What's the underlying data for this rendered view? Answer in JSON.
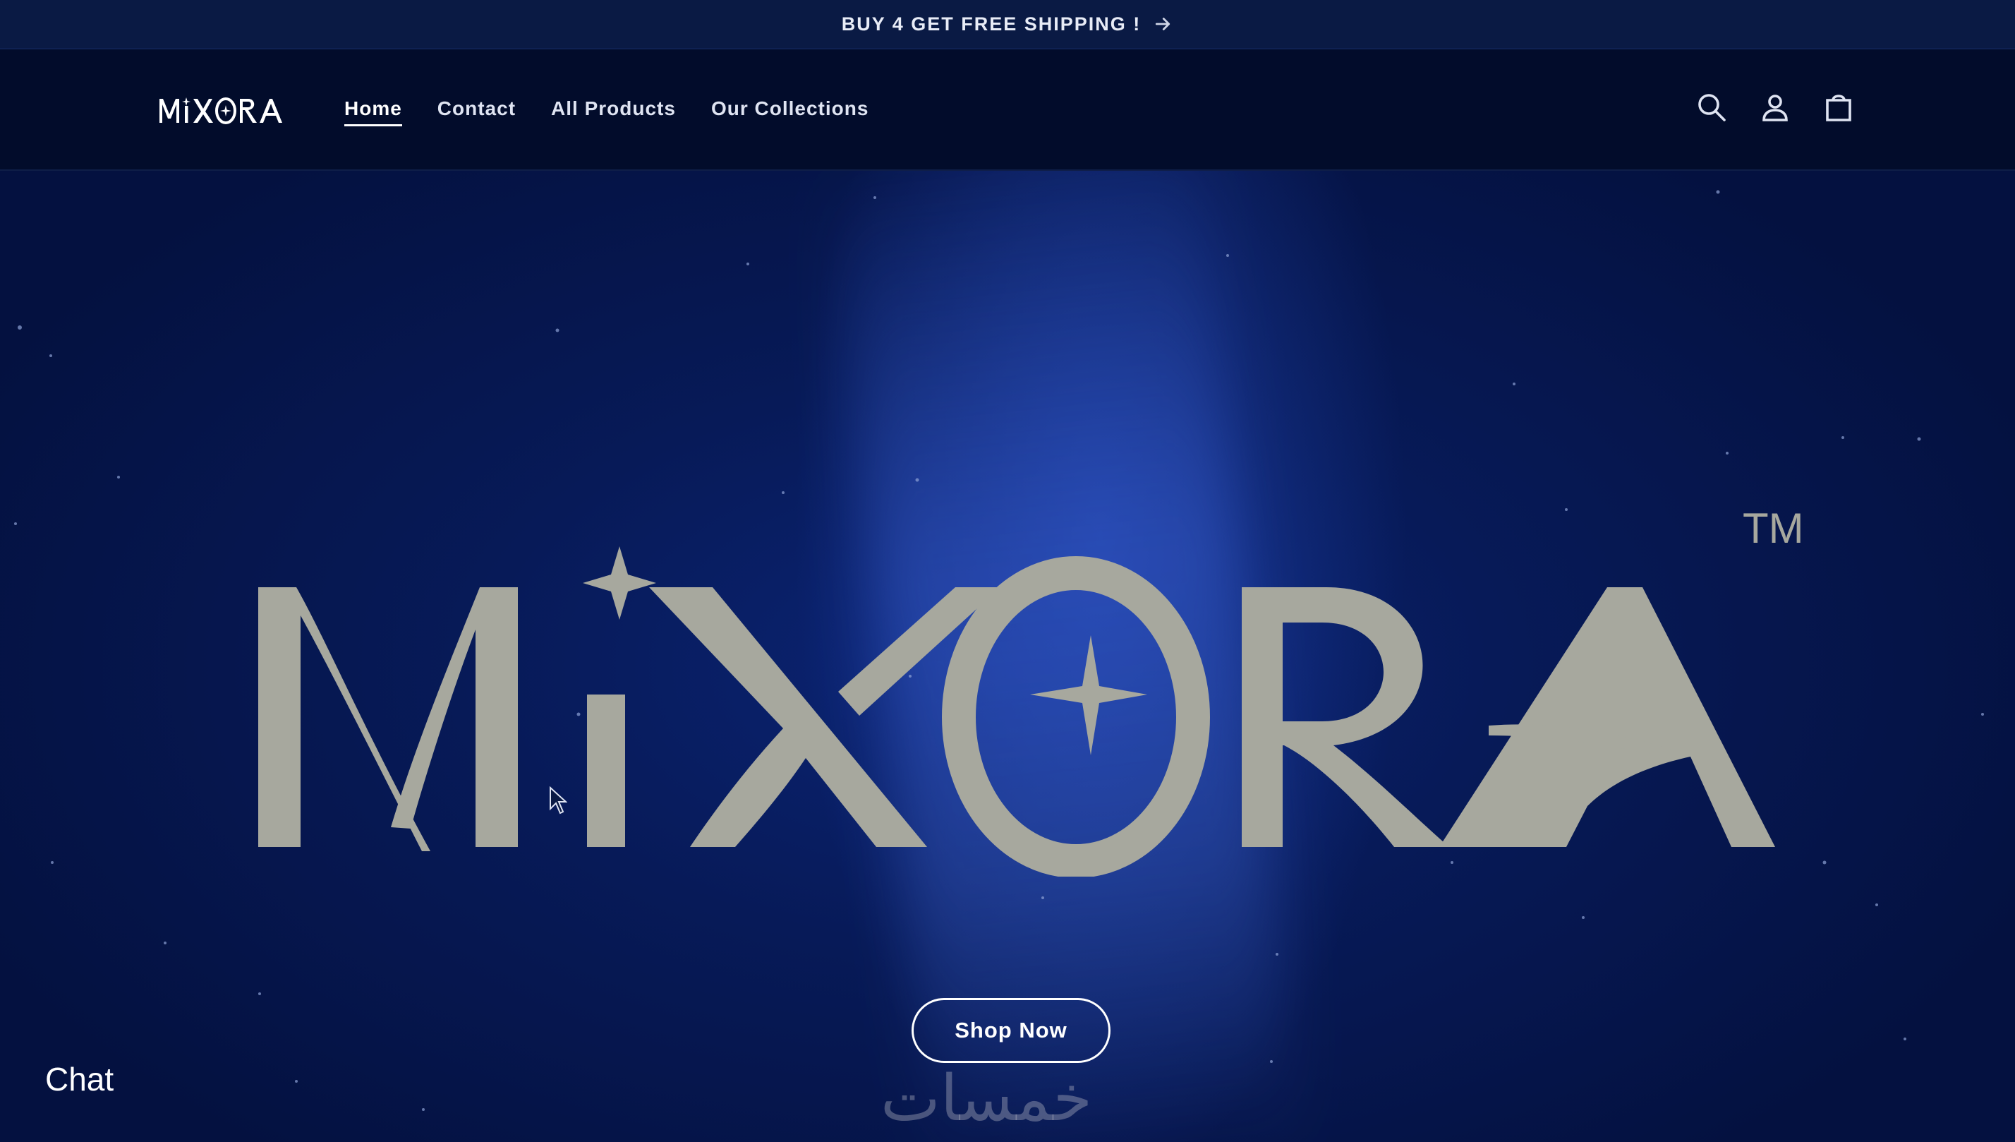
{
  "announcement": {
    "text": "BUY 4 GET FREE SHIPPING !",
    "arrow_icon": "arrow-right-icon"
  },
  "header": {
    "logo_text": "MiXORA",
    "nav": [
      {
        "label": "Home",
        "active": true
      },
      {
        "label": "Contact",
        "active": false
      },
      {
        "label": "All Products",
        "active": false
      },
      {
        "label": "Our Collections",
        "active": false
      }
    ],
    "icons": [
      "search-icon",
      "account-icon",
      "cart-icon"
    ]
  },
  "hero": {
    "brand": "MiXORA",
    "trademark": "TM",
    "cta_label": "Shop Now",
    "watermark": "خمسات"
  },
  "chat": {
    "label": "Chat"
  },
  "colors": {
    "background": "#041035",
    "header_bg": "#020c2b",
    "announcement_bg": "#0a1a44",
    "logo_color": "#a7a89e",
    "text_light": "#ffffff"
  }
}
